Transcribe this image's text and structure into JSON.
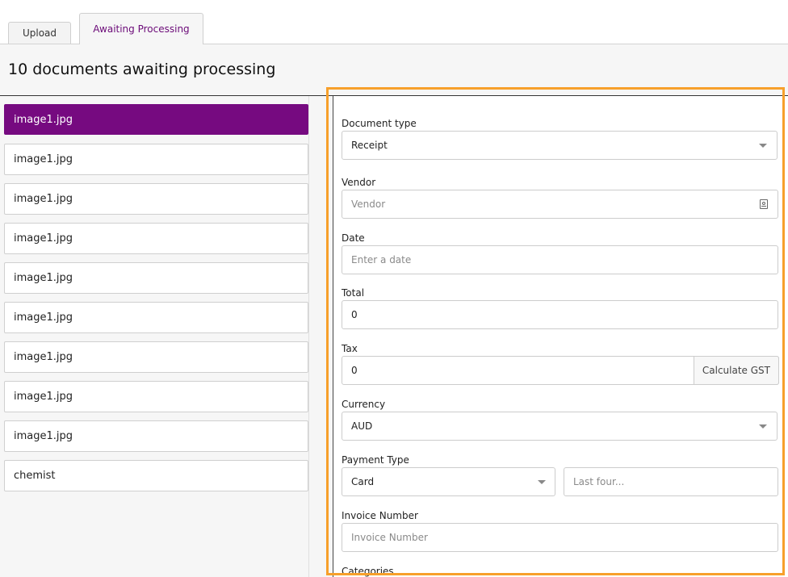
{
  "tabs": {
    "upload": "Upload",
    "awaiting": "Awaiting Processing"
  },
  "page": {
    "title": "10 documents awaiting processing"
  },
  "documents": [
    {
      "name": "image1.jpg",
      "active": true
    },
    {
      "name": "image1.jpg",
      "active": false
    },
    {
      "name": "image1.jpg",
      "active": false
    },
    {
      "name": "image1.jpg",
      "active": false
    },
    {
      "name": "image1.jpg",
      "active": false
    },
    {
      "name": "image1.jpg",
      "active": false
    },
    {
      "name": "image1.jpg",
      "active": false
    },
    {
      "name": "image1.jpg",
      "active": false
    },
    {
      "name": "image1.jpg",
      "active": false
    },
    {
      "name": "chemist",
      "active": false
    }
  ],
  "form": {
    "document_type": {
      "label": "Document type",
      "value": "Receipt"
    },
    "vendor": {
      "label": "Vendor",
      "placeholder": "Vendor"
    },
    "date": {
      "label": "Date",
      "placeholder": "Enter a date"
    },
    "total": {
      "label": "Total",
      "value": "0"
    },
    "tax": {
      "label": "Tax",
      "value": "0",
      "button": "Calculate GST"
    },
    "currency": {
      "label": "Currency",
      "value": "AUD"
    },
    "payment_type": {
      "label": "Payment Type",
      "value": "Card",
      "last_four_placeholder": "Last four..."
    },
    "invoice_number": {
      "label": "Invoice Number",
      "placeholder": "Invoice Number"
    },
    "categories": {
      "label": "Categories"
    }
  },
  "colors": {
    "accent": "#760a80",
    "highlight": "#f7a02b"
  },
  "icons": {
    "vendor_field": "contact-card-icon",
    "select": "caret-down-icon"
  }
}
